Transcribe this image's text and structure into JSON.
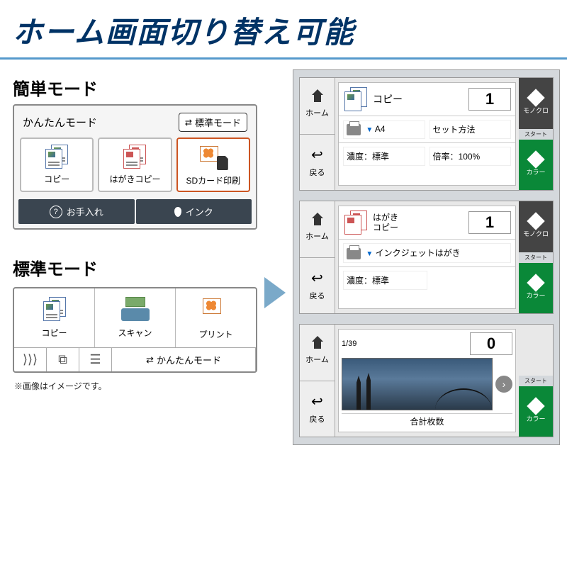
{
  "title": "ホーム画面切り替え可能",
  "simple_mode": {
    "section_label": "簡単モード",
    "panel_title": "かんたんモード",
    "switch_button": "標準モード",
    "tiles": [
      {
        "label": "コピー"
      },
      {
        "label": "はがきコピー"
      },
      {
        "label": "SDカード印刷"
      }
    ],
    "bottom_buttons": {
      "care": "お手入れ",
      "ink": "インク"
    }
  },
  "standard_mode": {
    "section_label": "標準モード",
    "tiles": [
      {
        "label": "コピー"
      },
      {
        "label": "スキャン"
      },
      {
        "label": "プリント"
      }
    ],
    "bottom_link": "かんたんモード"
  },
  "footnote": "※画像はイメージです。",
  "side": {
    "home": "ホーム",
    "back": "戻る"
  },
  "start_buttons": {
    "mono": "モノクロ",
    "start": "スタート",
    "color": "カラー"
  },
  "screen_copy": {
    "title": "コピー",
    "count": "1",
    "paper": "A4",
    "set_method": "セット方法",
    "density_label": "濃度：",
    "density_value": "標準",
    "ratio_label": "倍率：",
    "ratio_value": "100%"
  },
  "screen_hagaki": {
    "title_line1": "はがき",
    "title_line2": "コピー",
    "count": "1",
    "paper_type": "インクジェットはがき",
    "density_label": "濃度：",
    "density_value": "標準"
  },
  "screen_photo": {
    "index": "1/39",
    "count": "0",
    "total_label": "合計枚数"
  }
}
